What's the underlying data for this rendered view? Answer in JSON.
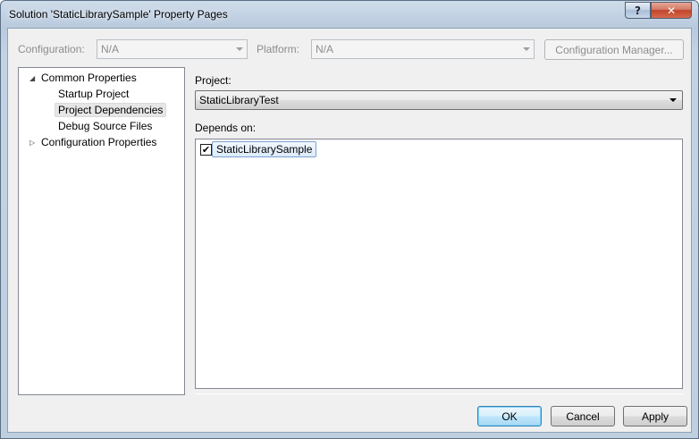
{
  "window": {
    "title": "Solution 'StaticLibrarySample' Property Pages",
    "help_glyph": "?",
    "close_glyph": "✕"
  },
  "config_bar": {
    "configuration_label": "Configuration:",
    "configuration_value": "N/A",
    "platform_label": "Platform:",
    "platform_value": "N/A",
    "config_manager_label": "Configuration Manager..."
  },
  "tree": {
    "common_toggle": "◢",
    "common_label": "Common Properties",
    "children": [
      "Startup Project",
      "Project Dependencies",
      "Debug Source Files"
    ],
    "config_toggle": "▷",
    "config_label": "Configuration Properties"
  },
  "main": {
    "project_label": "Project:",
    "project_value": "StaticLibraryTest",
    "depends_label": "Depends on:",
    "dependencies": [
      {
        "name": "StaticLibrarySample",
        "checked_glyph": "✔"
      }
    ]
  },
  "footer": {
    "ok_label": "OK",
    "cancel_label": "Cancel",
    "apply_label": "Apply"
  }
}
